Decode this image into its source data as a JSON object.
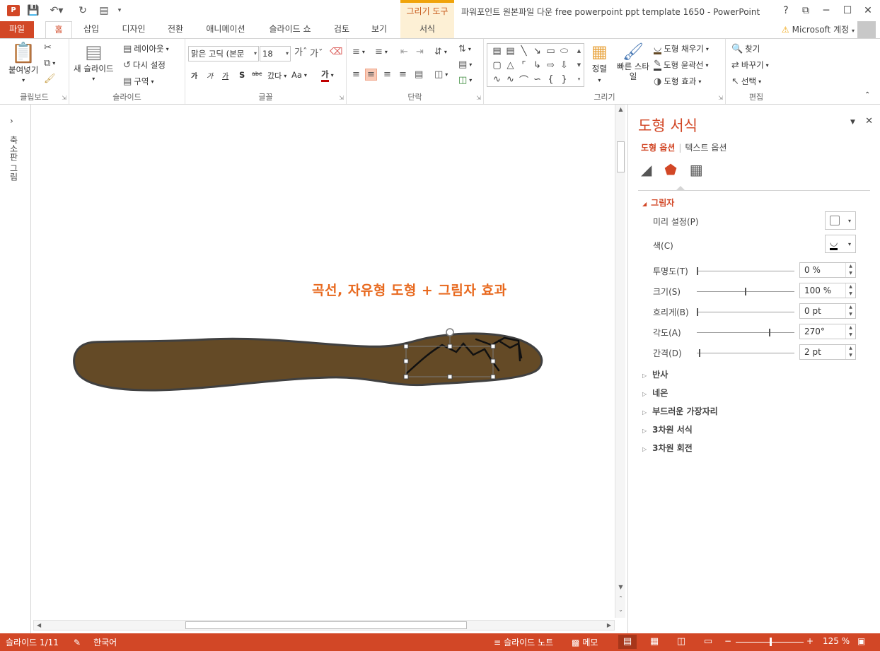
{
  "window": {
    "title": "파워포인트 원본파일 다운 free powerpoint ppt template 1650 - PowerPoint",
    "context_tab_group": "그리기 도구",
    "help": "?",
    "controls": [
      "?",
      "⧉",
      "─",
      "☐",
      "✕"
    ]
  },
  "app_icon": "P",
  "tabs": {
    "file": "파일",
    "items": [
      "홈",
      "삽입",
      "디자인",
      "전환",
      "애니메이션",
      "슬라이드 쇼",
      "검토",
      "보기"
    ],
    "active": "홈",
    "context": "서식",
    "account": "Microsoft 계정"
  },
  "ribbon": {
    "clipboard": {
      "label": "클립보드",
      "paste": "붙여넣기"
    },
    "slides": {
      "label": "슬라이드",
      "new_slide": "새 슬라이드",
      "layout": "레이아웃",
      "reset": "다시 설정",
      "section": "구역"
    },
    "font": {
      "label": "글꼴",
      "font_name": "맑은 고딕 (본문",
      "font_size": "18",
      "bold": "가",
      "italic": "가",
      "underline": "가",
      "shadow": "S",
      "strike": "abc",
      "spacing": "갔다",
      "case": "Aa",
      "color": "가"
    },
    "paragraph": {
      "label": "단락"
    },
    "drawing": {
      "label": "그리기",
      "arrange": "정렬",
      "quick_styles": "빠른 스타일",
      "fill": "도형 채우기",
      "outline": "도형 윤곽선",
      "effects": "도형 효과"
    },
    "editing": {
      "label": "편집",
      "find": "찾기",
      "replace": "바꾸기",
      "select": "선택"
    }
  },
  "thumbnail_pane": {
    "label": "축소판 그림"
  },
  "slide": {
    "title": "곡선, 자유형 도형 + 그림자 효과",
    "shape_fill": "#644a26",
    "shape_outline": "#404040"
  },
  "format_pane": {
    "title": "도형 서식",
    "tab_shape": "도형 옵션",
    "tab_text": "텍스트 옵션",
    "section_open": "그림자",
    "preset_label": "미리 설정(P)",
    "color_label": "색(C)",
    "props": [
      {
        "label": "투명도(T)",
        "value": "0 %",
        "level": 0.0
      },
      {
        "label": "크기(S)",
        "value": "100 %",
        "level": 0.5
      },
      {
        "label": "흐리게(B)",
        "value": "0 pt",
        "level": 0.0
      },
      {
        "label": "각도(A)",
        "value": "270°",
        "level": 0.75
      },
      {
        "label": "간격(D)",
        "value": "2 pt",
        "level": 0.02
      }
    ],
    "collapsed_sections": [
      "반사",
      "네온",
      "부드러운 가장자리",
      "3차원 서식",
      "3차원 회전"
    ]
  },
  "statusbar": {
    "slide_info": "슬라이드 1/11",
    "language": "한국어",
    "notes": "슬라이드 노트",
    "comments": "메모",
    "zoom": "125 %",
    "zoom_level": 0.5
  }
}
